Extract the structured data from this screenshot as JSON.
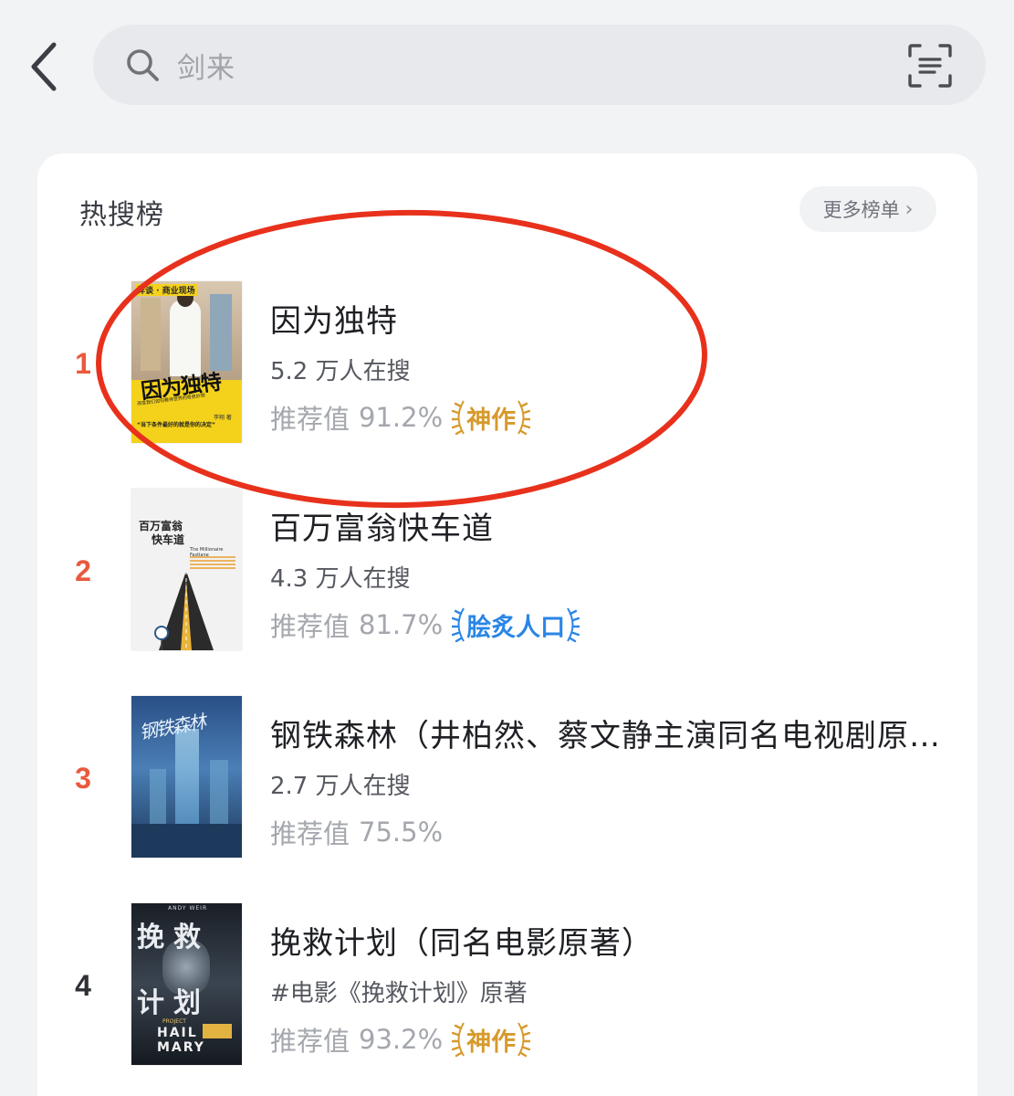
{
  "search": {
    "placeholder": "剑来"
  },
  "hot_list": {
    "title": "热搜榜",
    "more_label": "更多榜单",
    "items": [
      {
        "rank": "1",
        "title": "因为独特",
        "subtitle": "5.2 万人在搜",
        "rec_label": "推荐值",
        "rec_value": "91.2%",
        "badge": "神作",
        "badge_color": "#d69a2d",
        "cover": {
          "tag": "详谈 · 商业现场",
          "big": "因为独特",
          "small": "改变我们如何看待世界的奇思妙想",
          "quote": "“当下条件最好的就是你的决定”",
          "author": "李翔 著"
        }
      },
      {
        "rank": "2",
        "title": "百万富翁快车道",
        "subtitle": "4.3 万人在搜",
        "rec_label": "推荐值",
        "rec_value": "81.7%",
        "badge": "脍炙人口",
        "badge_color": "#2a86e6",
        "cover": {
          "big1": "百万富翁",
          "big2": "快车道",
          "en": "The Millionaire Fastlane"
        }
      },
      {
        "rank": "3",
        "title": "钢铁森林（井柏然、蔡文静主演同名电视剧原…",
        "subtitle": "2.7 万人在搜",
        "rec_label": "推荐值",
        "rec_value": "75.5%",
        "badge": "",
        "cover": {
          "big": "钢铁森林"
        }
      },
      {
        "rank": "4",
        "title": "挽救计划（同名电影原著）",
        "subtitle": "#电影《挽救计划》原著",
        "rec_label": "推荐值",
        "rec_value": "93.2%",
        "badge": "神作",
        "badge_color": "#d69a2d",
        "cover": {
          "author": "ANDY WEIR",
          "big1": "挽救",
          "big2": "计划",
          "en1": "PROJECT",
          "en2": "HAIL MARY"
        }
      }
    ]
  },
  "colors": {
    "accent_red": "#e9593d",
    "annotation_red": "#e8311c",
    "gold": "#d69a2d",
    "blue": "#2a86e6"
  }
}
